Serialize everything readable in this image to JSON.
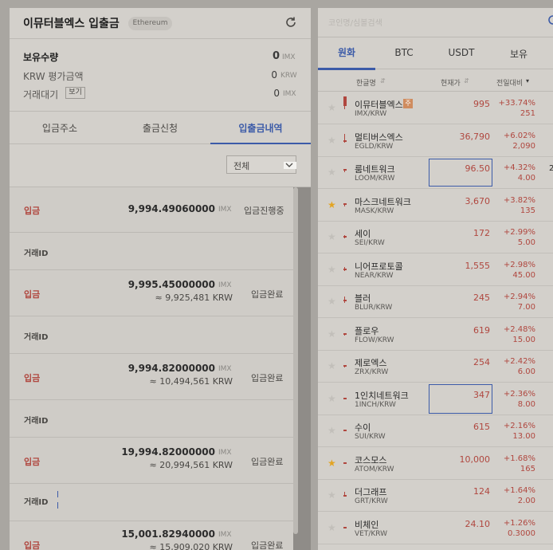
{
  "left": {
    "title": "이뮤터블엑스 입출금",
    "network": "Ethereum",
    "holdings_label": "보유수량",
    "holdings_value": "0",
    "holdings_unit": "IMX",
    "krw_label": "KRW 평가금액",
    "krw_value": "0",
    "krw_unit": "KRW",
    "pending_label": "거래대기",
    "view_label": "보기",
    "pending_value": "0",
    "pending_unit": "IMX",
    "tabs": [
      "입금주소",
      "출금신청",
      "입출금내역"
    ],
    "filter": "전체",
    "tx_label": "거래ID",
    "records": [
      {
        "type": "입금",
        "amount": "9,994.49060000",
        "unit": "IMX",
        "krw": "",
        "status": "입금진행중"
      },
      {
        "type": "입금",
        "amount": "9,995.45000000",
        "unit": "IMX",
        "krw": "≈ 9,925,481 KRW",
        "status": "입금완료"
      },
      {
        "type": "입금",
        "amount": "9,994.82000000",
        "unit": "IMX",
        "krw": "≈ 10,494,561 KRW",
        "status": "입금완료"
      },
      {
        "type": "입금",
        "amount": "19,994.82000000",
        "unit": "IMX",
        "krw": "≈ 20,994,561 KRW",
        "status": "입금완료"
      },
      {
        "type": "입금",
        "amount": "15,001.82940000",
        "unit": "IMX",
        "krw": "≈ 15,909,020 KRW",
        "status": "입금완료"
      }
    ]
  },
  "right": {
    "search_placeholder": "코인명/심볼검색",
    "tabs": [
      "원화",
      "BTC",
      "USDT",
      "보유"
    ],
    "cols": {
      "name": "한글명",
      "price": "현재가",
      "change": "전일대비"
    },
    "coins": [
      {
        "name": "이뮤터블엑스",
        "sym": "IMX/KRW",
        "price": "995",
        "pct": "+33.74%",
        "amt": "251",
        "fav": false,
        "badge": "주"
      },
      {
        "name": "멀티버스엑스",
        "sym": "EGLD/KRW",
        "price": "36,790",
        "pct": "+6.02%",
        "amt": "2,090",
        "fav": false,
        "badge": ""
      },
      {
        "name": "룸네트워크",
        "sym": "LOOM/KRW",
        "price": "96.50",
        "pct": "+4.32%",
        "amt": "4.00",
        "fav": false,
        "badge": ""
      },
      {
        "name": "마스크네트워크",
        "sym": "MASK/KRW",
        "price": "3,670",
        "pct": "+3.82%",
        "amt": "135",
        "fav": true,
        "badge": ""
      },
      {
        "name": "세이",
        "sym": "SEI/KRW",
        "price": "172",
        "pct": "+2.99%",
        "amt": "5.00",
        "fav": false,
        "badge": ""
      },
      {
        "name": "니어프로토콜",
        "sym": "NEAR/KRW",
        "price": "1,555",
        "pct": "+2.98%",
        "amt": "45.00",
        "fav": false,
        "badge": ""
      },
      {
        "name": "블러",
        "sym": "BLUR/KRW",
        "price": "245",
        "pct": "+2.94%",
        "amt": "7.00",
        "fav": false,
        "badge": ""
      },
      {
        "name": "플로우",
        "sym": "FLOW/KRW",
        "price": "619",
        "pct": "+2.48%",
        "amt": "15.00",
        "fav": false,
        "badge": ""
      },
      {
        "name": "제로엑스",
        "sym": "ZRX/KRW",
        "price": "254",
        "pct": "+2.42%",
        "amt": "6.00",
        "fav": false,
        "badge": ""
      },
      {
        "name": "1인치네트워크",
        "sym": "1INCH/KRW",
        "price": "347",
        "pct": "+2.36%",
        "amt": "8.00",
        "fav": false,
        "badge": ""
      },
      {
        "name": "수이",
        "sym": "SUI/KRW",
        "price": "615",
        "pct": "+2.16%",
        "amt": "13.00",
        "fav": false,
        "badge": ""
      },
      {
        "name": "코스모스",
        "sym": "ATOM/KRW",
        "price": "10,000",
        "pct": "+1.68%",
        "amt": "165",
        "fav": true,
        "badge": ""
      },
      {
        "name": "더그래프",
        "sym": "GRT/KRW",
        "price": "124",
        "pct": "+1.64%",
        "amt": "2.00",
        "fav": false,
        "badge": ""
      },
      {
        "name": "비체인",
        "sym": "VET/KRW",
        "price": "24.10",
        "pct": "+1.26%",
        "amt": "0.3000",
        "fav": false,
        "badge": ""
      }
    ],
    "edge_text": "2"
  },
  "colors": {
    "rise": "#b0473f",
    "accent": "#3c5ba8",
    "star_on": "#e3a422"
  }
}
